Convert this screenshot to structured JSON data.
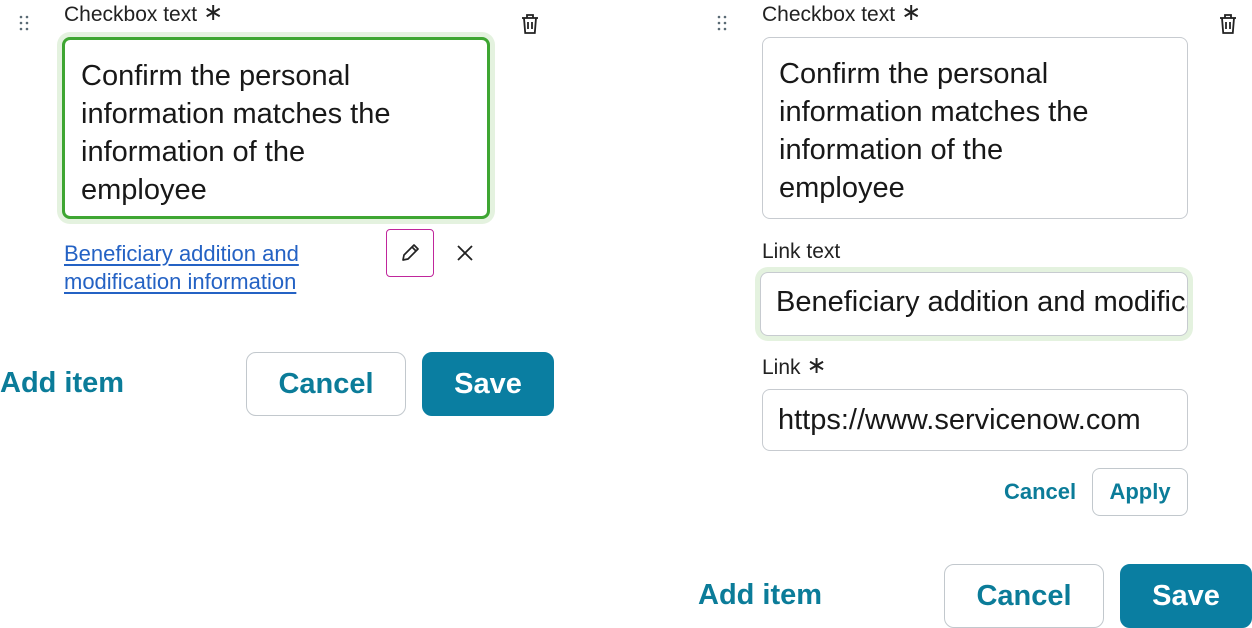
{
  "left_panel": {
    "checkbox_label": "Checkbox text",
    "required_marker": "∗",
    "checkbox_value": "Confirm the personal\ninformation matches the\ninformation of the\nemployee",
    "link_line1": "Beneficiary addition and",
    "link_line2": "modification information",
    "add_item": "Add item",
    "cancel": "Cancel",
    "save": "Save"
  },
  "right_panel": {
    "checkbox_label": "Checkbox text",
    "required_marker": "∗",
    "checkbox_value": "Confirm the personal\ninformation matches the\ninformation of the\nemployee",
    "link_text_label": "Link text",
    "link_text_value": "Beneficiary addition and modification information",
    "link_label": "Link",
    "link_marker": "∗",
    "link_value": "https://www.servicenow.com",
    "link_cancel": "Cancel",
    "link_apply": "Apply",
    "add_item": "Add item",
    "cancel": "Cancel",
    "save": "Save"
  },
  "colors": {
    "accent": "#0a7ea1",
    "focus_border": "#3ea632",
    "link": "#2462c4",
    "edit_outline": "#c0269c"
  },
  "icons": [
    "drag-handle-icon",
    "trash-icon",
    "pencil-icon",
    "close-icon"
  ]
}
